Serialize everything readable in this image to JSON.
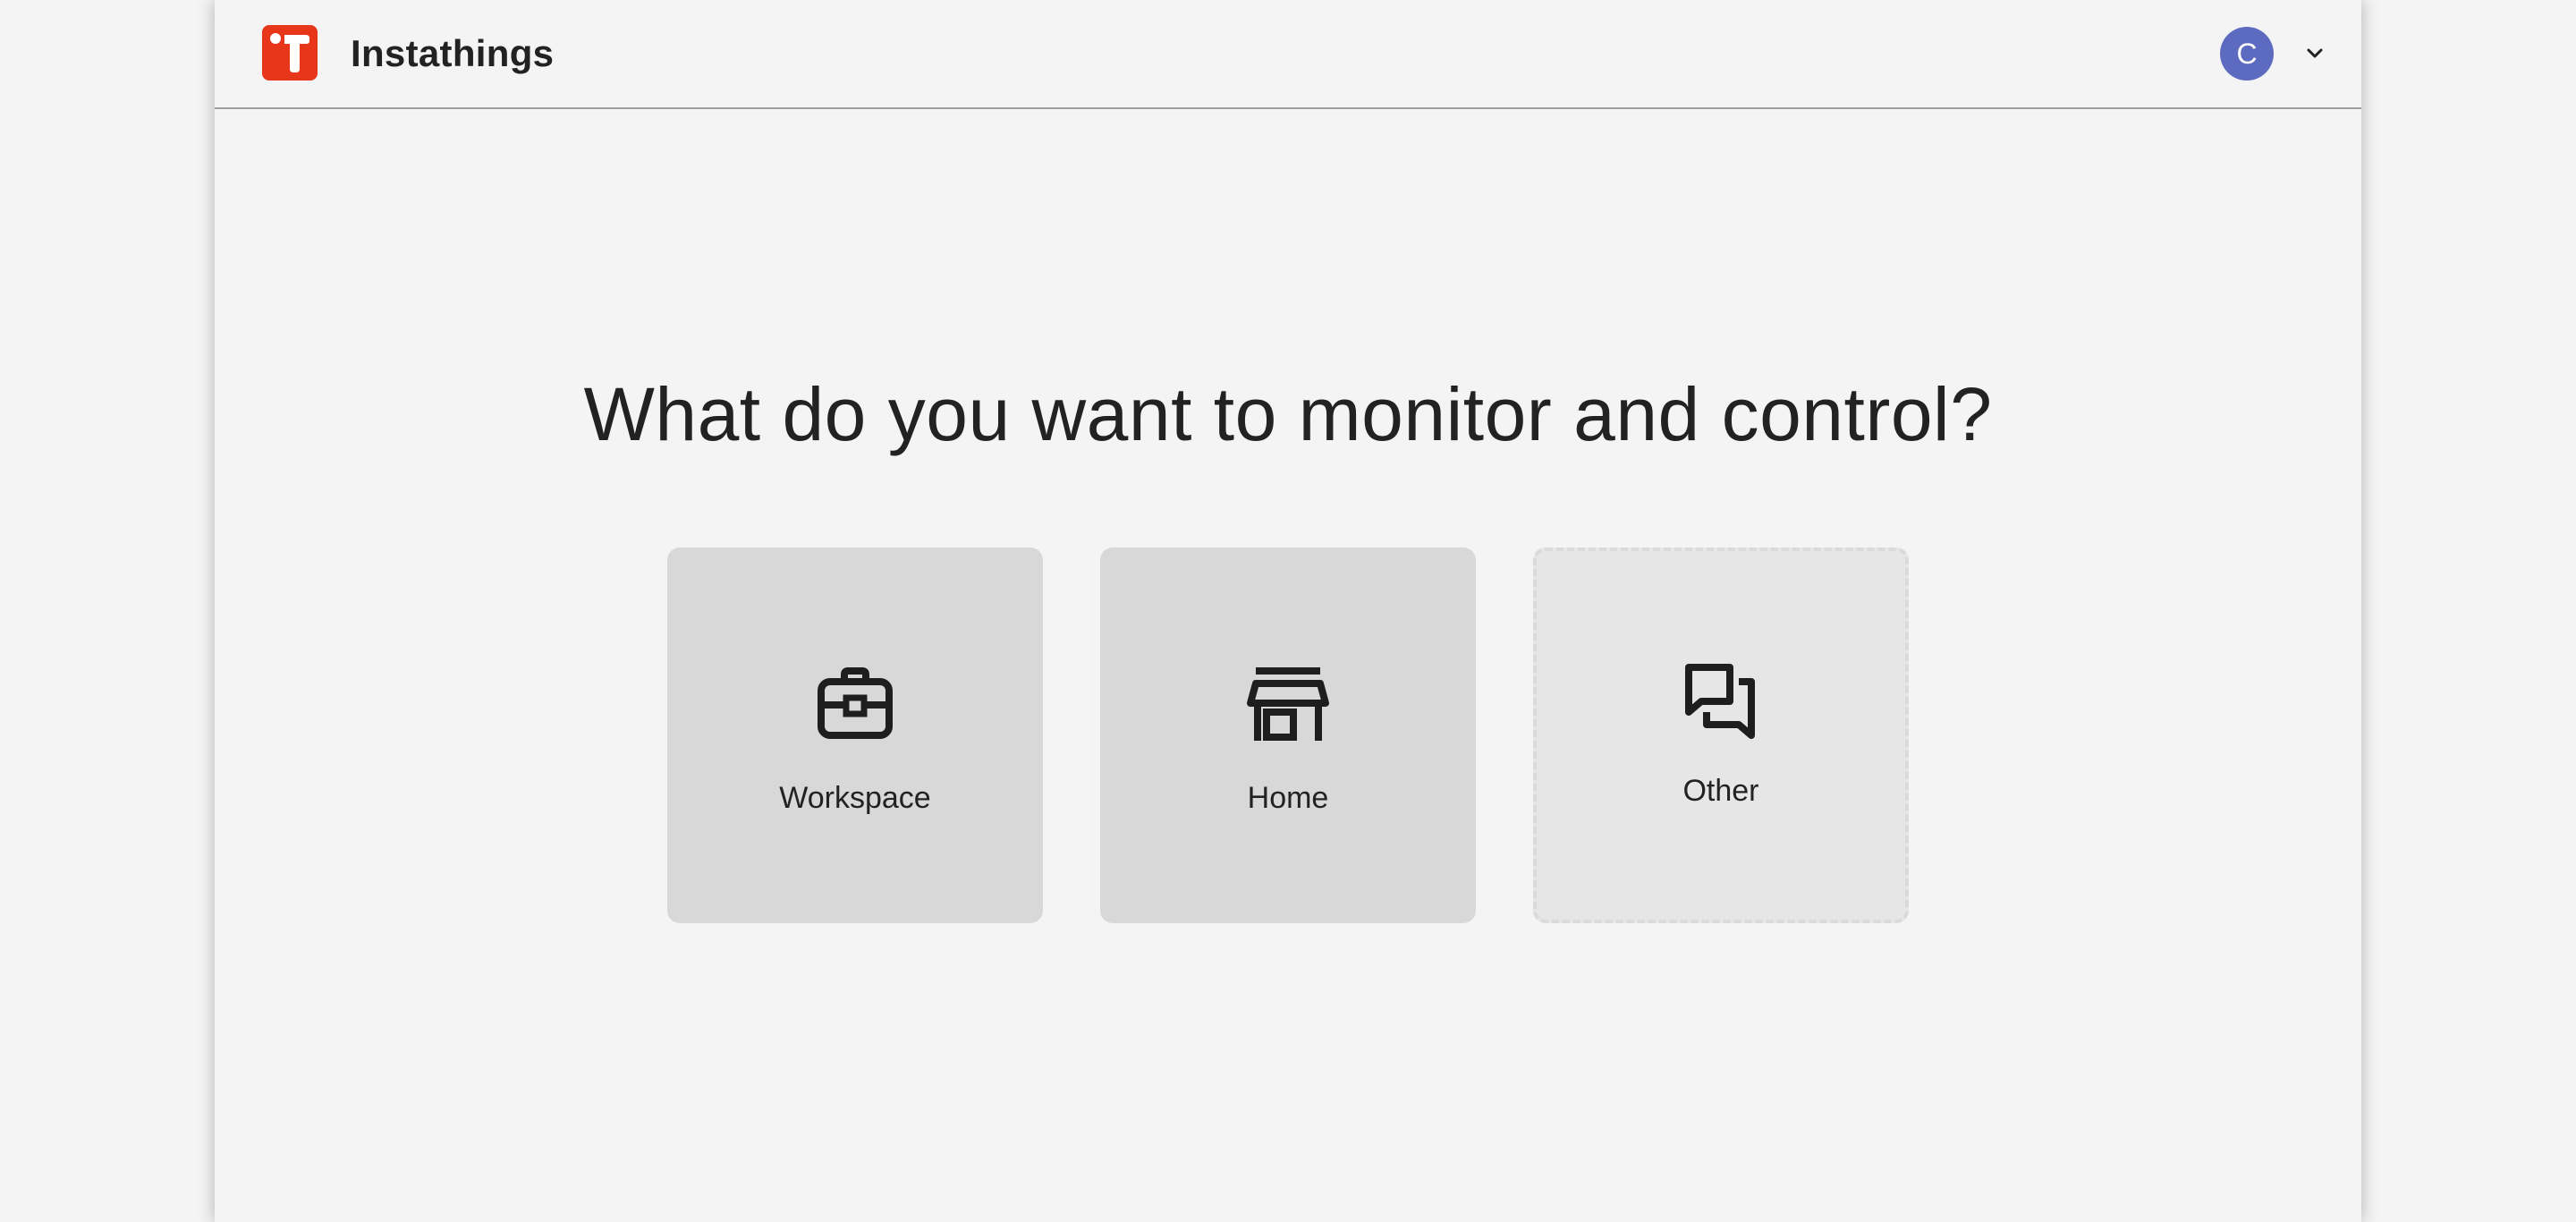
{
  "header": {
    "app_title": "Instathings",
    "logo_icon": "instathings-logo-icon",
    "user_initial": "C",
    "user_menu_icon": "chevron-down-icon"
  },
  "main": {
    "question": "What do you want to monitor and control?",
    "options": [
      {
        "label": "Workspace",
        "icon": "briefcase-icon"
      },
      {
        "label": "Home",
        "icon": "storefront-icon"
      },
      {
        "label": "Other",
        "icon": "chat-bubbles-icon"
      }
    ]
  },
  "colors": {
    "brand": "#e8361b",
    "avatar": "#5c6bc0",
    "background": "#f4f4f4",
    "card": "#d8d8d8",
    "card_other": "#e6e6e6",
    "text": "#222222"
  }
}
